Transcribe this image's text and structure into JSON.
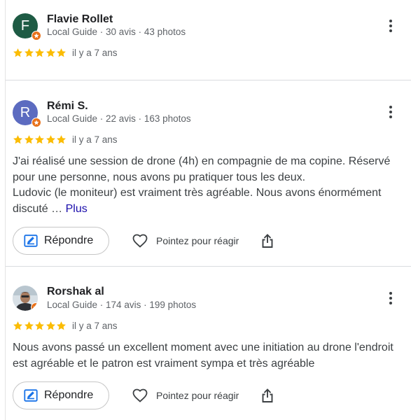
{
  "colors": {
    "star": "#fbbc04",
    "link": "#1a0dab",
    "badge": "#e8711a"
  },
  "reviews": [
    {
      "name": "Flavie Rollet",
      "initial": "F",
      "avatar_color": "#1e5b44",
      "meta": "Local Guide · 30 avis · 43 photos",
      "rating": 5,
      "date": "il y a 7 ans"
    },
    {
      "name": "Rémi S.",
      "initial": "R",
      "avatar_color": "#5c6bc0",
      "meta": "Local Guide · 22 avis · 163 photos",
      "rating": 5,
      "date": "il y a 7 ans",
      "text_lines": [
        "J'ai réalisé une session de drone (4h) en compagnie de ma copine. Réservé pour une personne, nous avons pu pratiquer tous les deux.",
        "Ludovic (le moniteur) est vraiment très agréable. Nous avons énormément discuté … "
      ],
      "more_label": "Plus",
      "reply_label": "Répondre",
      "react_label": "Pointez pour réagir"
    },
    {
      "name": "Rorshak al",
      "meta": "Local Guide · 174 avis · 199 photos",
      "rating": 5,
      "date": "il y a 7 ans",
      "text": "Nous avons passé un excellent moment avec une initiation au drone l'endroit est agréable et le patron est vraiment sympa et très agréable",
      "reply_label": "Répondre",
      "react_label": "Pointez pour réagir"
    }
  ]
}
